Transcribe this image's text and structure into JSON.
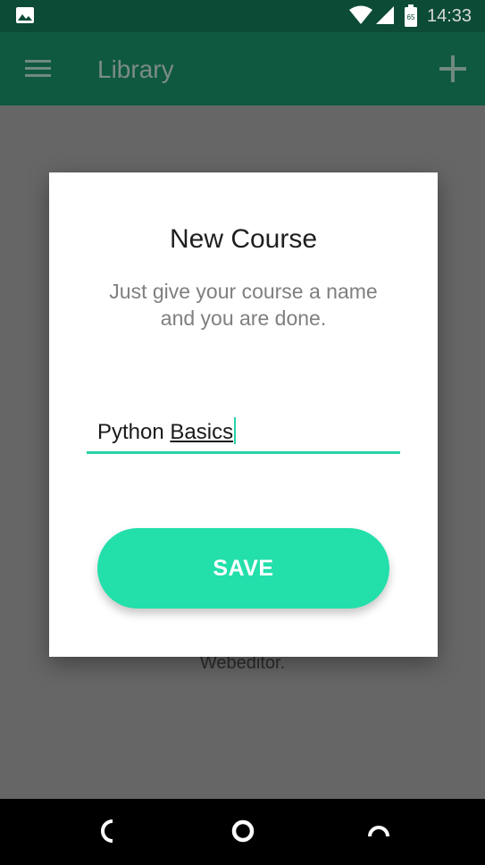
{
  "status_bar": {
    "time": "14:33",
    "battery_level": "65",
    "icons": [
      "gallery-icon",
      "wifi-icon",
      "signal-icon",
      "battery-icon"
    ]
  },
  "app_bar": {
    "title": "Library",
    "icons": [
      "menu-icon",
      "add-icon"
    ]
  },
  "background": {
    "partial_text": "Webeditor."
  },
  "dialog": {
    "title": "New Course",
    "subtitle_line1": "Just give your course a name",
    "subtitle_line2": "and you are done.",
    "input": {
      "value_part1": "Python ",
      "value_part2": "Basics"
    },
    "save_label": "SAVE"
  },
  "nav_bar": {
    "icons": [
      "back-icon",
      "home-icon",
      "recents-icon"
    ]
  },
  "colors": {
    "accent": "#23dfaa",
    "status_bar": "#0c4b36",
    "app_bar": "#0f5940",
    "scrim": "#666666"
  }
}
